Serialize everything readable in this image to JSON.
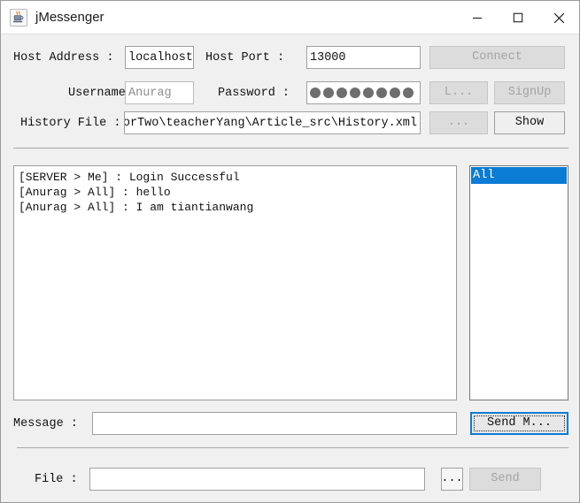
{
  "window": {
    "title": "jMessenger",
    "icon": "java-coffee-cup-icon",
    "minimize_label": "—",
    "maximize_label": "□",
    "close_label": "✕"
  },
  "colors": {
    "selection_blue": "#0a7cd4",
    "focus_blue": "#0a7cd4",
    "window_bg": "#f0f0f0",
    "field_bg": "#ffffff",
    "disabled_text": "#a3a3a3"
  },
  "form": {
    "host_address_label": "Host Address :",
    "host_address_value": "localhost",
    "host_port_label": "Host Port :",
    "host_port_value": "13000",
    "connect_label": "Connect",
    "connect_enabled": false,
    "username_label": "Username :",
    "username_value": "Anurag",
    "username_enabled": false,
    "password_label": "Password :",
    "password_dots": 8,
    "login_label": "L...",
    "login_enabled": false,
    "signup_label": "SignUp",
    "signup_enabled": false,
    "history_file_label": "History File :",
    "history_file_value": "orTwo\\teacherYang\\Article_src\\History.xml",
    "history_browse_label": "...",
    "history_browse_enabled": false,
    "show_label": "Show",
    "show_enabled": true
  },
  "chat": {
    "lines": [
      "[SERVER > Me] : Login Successful",
      "[Anurag > All] : hello",
      "[Anurag > All] : I am tiantianwang"
    ]
  },
  "users": {
    "items": [
      {
        "label": "All",
        "selected": true
      }
    ]
  },
  "message_row": {
    "label": "Message :",
    "value": "",
    "placeholder": "",
    "send_label": "Send M...",
    "send_enabled": true,
    "send_focused": true
  },
  "file_row": {
    "label": "File :",
    "value": "",
    "placeholder": "",
    "browse_label": "...",
    "browse_enabled": true,
    "send_label": "Send",
    "send_enabled": false
  }
}
